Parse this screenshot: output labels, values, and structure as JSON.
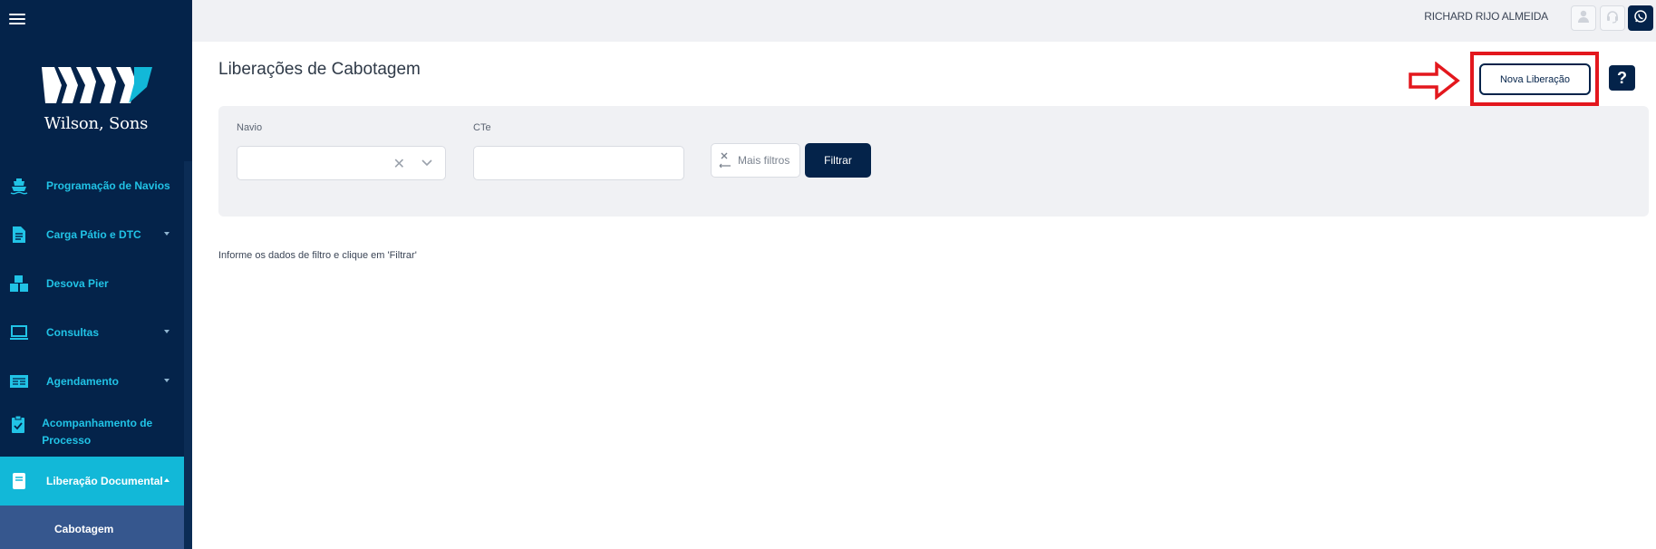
{
  "sidebar": {
    "logo_text": "Wilson, Sons",
    "items": [
      {
        "label": "Programação de Navios",
        "icon": "ship-icon"
      },
      {
        "label": "Carga Pátio e DTC",
        "icon": "document-icon"
      },
      {
        "label": "Desova Pier",
        "icon": "boxes-icon"
      },
      {
        "label": "Consultas",
        "icon": "laptop-icon"
      },
      {
        "label": "Agendamento",
        "icon": "schedule-card-icon"
      },
      {
        "label": "Acompanhamento de Processo",
        "icon": "clipboard-check-icon"
      },
      {
        "label": "Liberação Documental",
        "icon": "notebook-icon"
      }
    ],
    "submenu": [
      {
        "label": "Cabotagem"
      }
    ]
  },
  "topbar": {
    "user_name": "RICHARD RIJO ALMEIDA",
    "icons": [
      "user-icon",
      "headset-icon",
      "whatsapp-icon"
    ]
  },
  "main": {
    "title": "Liberações de Cabotagem",
    "nova_button_label": "Nova Liberação",
    "help_label": "?",
    "hint": "Informe os dados de filtro e clique em 'Filtrar'"
  },
  "filters": {
    "navio_label": "Navio",
    "navio_value": "",
    "cte_label": "CTe",
    "cte_value": "",
    "mais_filtros_label": "Mais filtros",
    "filtrar_label": "Filtrar"
  },
  "colors": {
    "sidebar_bg": "#04234a",
    "accent": "#12b8d8",
    "menu_text": "#21c3e6",
    "submenu_bg": "#36578e",
    "highlight": "#e3171d"
  }
}
